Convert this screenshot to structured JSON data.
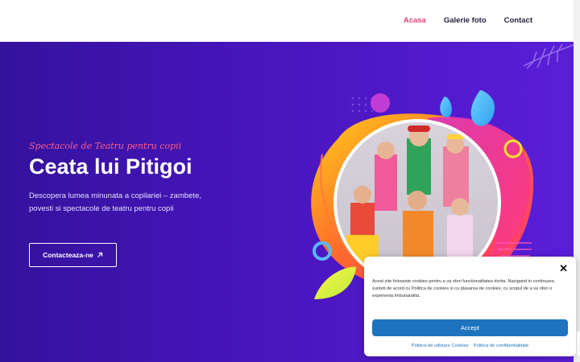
{
  "nav": {
    "items": [
      {
        "label": "Acasa",
        "active": true
      },
      {
        "label": "Galerie foto",
        "active": false
      },
      {
        "label": "Contact",
        "active": false
      }
    ]
  },
  "hero": {
    "subtitle": "Spectacole de Teatru pentru copii",
    "title": "Ceata lui Pitigoi",
    "description": "Descopera lumea minunata a copilariei – zambete, povesti si spectacole de teatru pentru copii",
    "cta_label": "Contacteaza-ne",
    "cta_icon": "arrow-up-right-icon"
  },
  "cookie": {
    "text": "Acest site foloseste cookies pentru a va oferi functionalitatea dorita. Navigand in continuare, sunteti de acord cu Politica de cookies si cu plasarea de cookies, cu scopul de a va oferi o experienta imbunatatita.",
    "accept_label": "Accept",
    "links": [
      "Politica de utilizare Cookies",
      "Politica de confidentialitate"
    ]
  },
  "colors": {
    "accent": "#e8407d",
    "hero_start": "#34129c",
    "hero_end": "#5a1ed8",
    "button_blue": "#1e73be"
  }
}
